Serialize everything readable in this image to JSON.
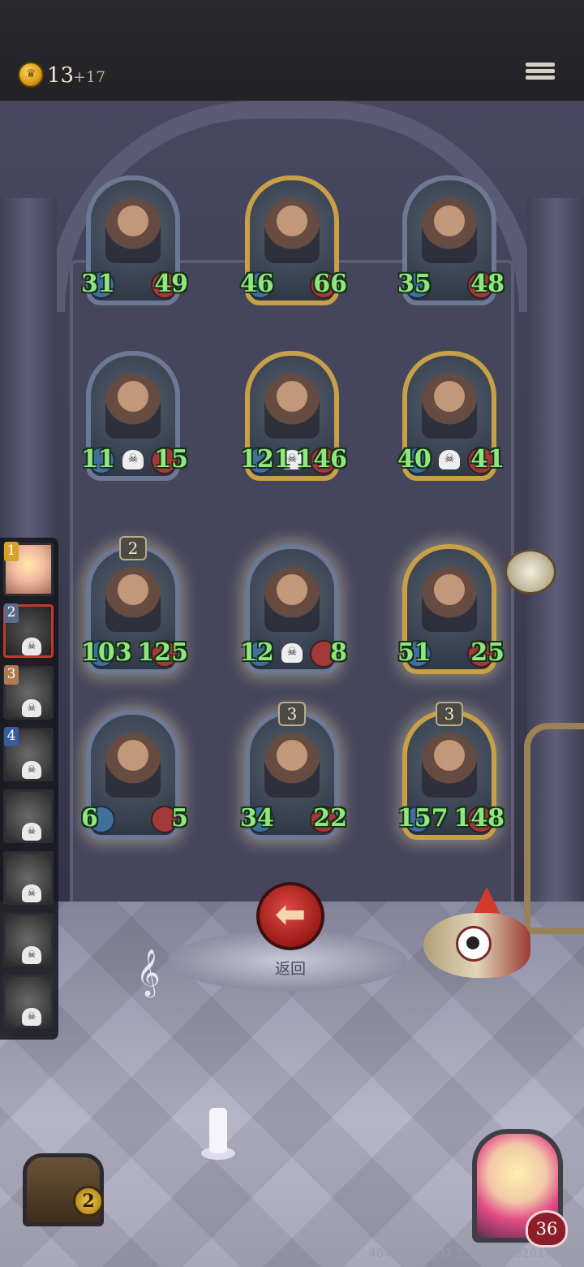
{
  "topbar": {
    "gold": "13",
    "gold_income": "+17",
    "coin_icon": "crown"
  },
  "board": {
    "rows": [
      [
        {
          "name": "",
          "atk": "31",
          "hp": "49",
          "frame": "silver",
          "level": "",
          "skull": false,
          "glow": false
        },
        {
          "name": "",
          "atk": "46",
          "hp": "66",
          "frame": "gold",
          "level": "",
          "skull": false,
          "glow": false
        },
        {
          "name": "",
          "atk": "35",
          "hp": "48",
          "frame": "silver",
          "level": "",
          "skull": false,
          "glow": false
        }
      ],
      [
        {
          "name": "",
          "atk": "11",
          "hp": "15",
          "frame": "silver",
          "level": "",
          "skull": true,
          "glow": false
        },
        {
          "name": "",
          "atk": "121",
          "hp": "146",
          "frame": "gold",
          "level": "",
          "skull": true,
          "glow": false
        },
        {
          "name": "",
          "atk": "40",
          "hp": "41",
          "frame": "gold",
          "level": "",
          "skull": true,
          "glow": false
        }
      ],
      [
        {
          "name": "",
          "atk": "103",
          "hp": "125",
          "frame": "silver",
          "level": "2",
          "skull": false,
          "glow": true
        },
        {
          "name": "",
          "atk": "12",
          "hp": "8",
          "frame": "silver",
          "level": "",
          "skull": true,
          "glow": true
        },
        {
          "name": "",
          "atk": "51",
          "hp": "25",
          "frame": "gold",
          "level": "",
          "skull": false,
          "glow": true
        }
      ],
      [
        {
          "name": "",
          "atk": "6",
          "hp": "5",
          "frame": "silver",
          "level": "",
          "skull": false,
          "glow": true
        },
        {
          "name": "",
          "atk": "34",
          "hp": "22",
          "frame": "silver",
          "level": "3",
          "skull": false,
          "glow": true
        },
        {
          "name": "",
          "atk": "157",
          "hp": "148",
          "frame": "gold",
          "level": "3",
          "skull": false,
          "glow": true
        }
      ]
    ]
  },
  "sidebar": {
    "slots": [
      {
        "num": "1",
        "num_color": "#d8a12a",
        "state": "first",
        "skull": false
      },
      {
        "num": "2",
        "num_color": "#5a6a8a",
        "state": "active",
        "skull": true
      },
      {
        "num": "3",
        "num_color": "#b07a50",
        "state": "",
        "skull": true
      },
      {
        "num": "4",
        "num_color": "#3a5aa0",
        "state": "",
        "skull": true
      },
      {
        "num": "",
        "num_color": "",
        "state": "",
        "skull": true
      },
      {
        "num": "",
        "num_color": "",
        "state": "",
        "skull": true
      },
      {
        "num": "",
        "num_color": "",
        "state": "",
        "skull": true
      },
      {
        "num": "",
        "num_color": "",
        "state": "",
        "skull": true
      }
    ]
  },
  "center": {
    "back_label": "返回",
    "back_icon": "left-arrow"
  },
  "bottom": {
    "chest_count": "2",
    "hero_hp": "36",
    "version": "40456648107 1.3.018 09201402"
  },
  "colors": {
    "stat_green": "#8fe87b",
    "back_red": "#c2302a",
    "gold_frame": "#c8a048"
  }
}
